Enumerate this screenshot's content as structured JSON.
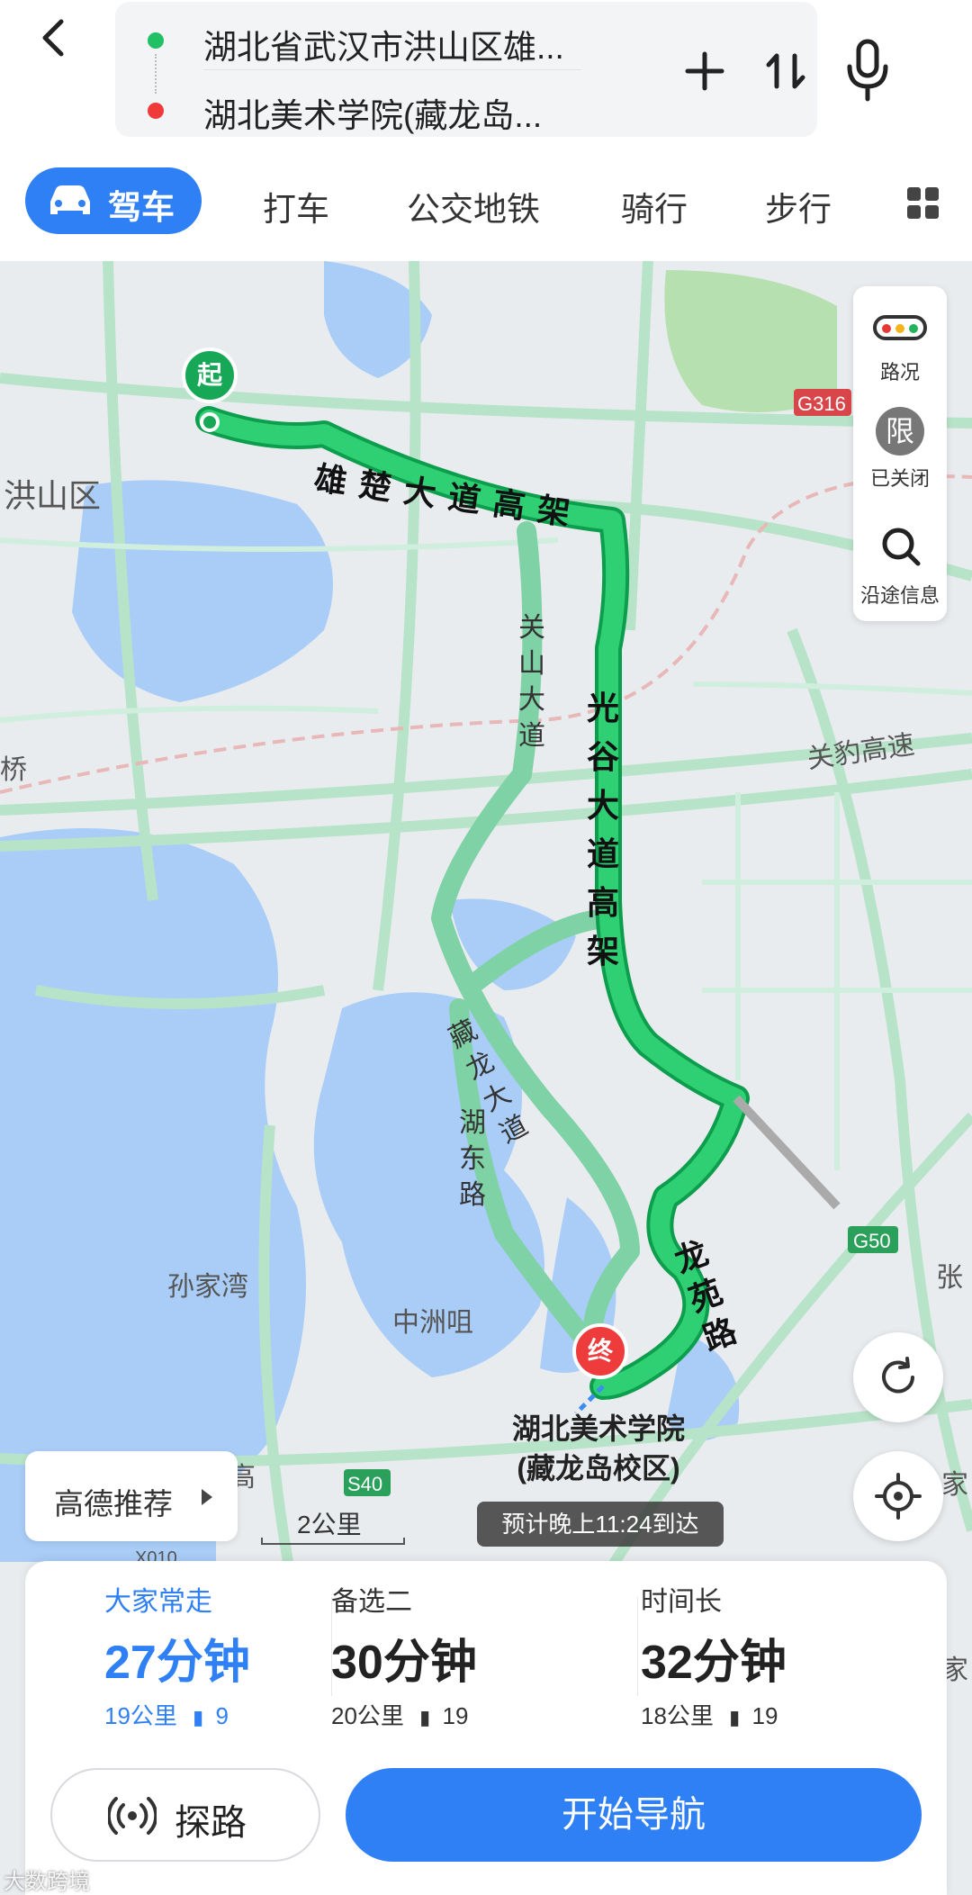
{
  "header": {
    "origin": "湖北省武汉市洪山区雄...",
    "destination": "湖北美术学院(藏龙岛...",
    "icons": [
      "back-arrow-icon",
      "add-icon",
      "swap-icon",
      "microphone-icon"
    ]
  },
  "modes": {
    "drive": "驾车",
    "taxi": "打车",
    "transit": "公交地铁",
    "cycle": "骑行",
    "walk": "步行",
    "more_icon": "grid-icon"
  },
  "tools": {
    "traffic": "路况",
    "restrict_badge": "限",
    "restrict": "已关闭",
    "along": "沿途信息"
  },
  "map": {
    "start_marker": "起",
    "end_marker": "终",
    "destination_label_line1": "湖北美术学院",
    "destination_label_line2": "(藏龙岛校区)",
    "eta": "预计晚上11:24到达",
    "scale": "2公里",
    "recommend": "高德推荐",
    "places": {
      "hongshan": "洪山区",
      "sunjiawan": "孙家湾",
      "zhongzhouju": "中洲咀",
      "guanbao": "关豹高速",
      "g316": "G316",
      "g50": "G50",
      "s40": "S40",
      "qiao": "桥",
      "zhang": "张",
      "jia": "家",
      "jia2": "家",
      "gao": "高",
      "x010": "X010"
    },
    "roads": {
      "xiongchu": "雄楚大道高架",
      "guanggu": "光谷大道高架",
      "guanshan": "关山大道",
      "canglong": "藏龙大道",
      "hudong": "湖东路",
      "longyuan": "龙苑路"
    }
  },
  "routes": [
    {
      "tag": "大家常走",
      "time": "27分钟",
      "distance": "19公里",
      "lights": "9"
    },
    {
      "tag": "备选二",
      "time": "30分钟",
      "distance": "20公里",
      "lights": "19"
    },
    {
      "tag": "时间长",
      "time": "32分钟",
      "distance": "18公里",
      "lights": "19"
    }
  ],
  "actions": {
    "explore": "探路",
    "navigate": "开始导航"
  },
  "watermark": "大数跨境",
  "colors": {
    "accent": "#2f7ff5",
    "route": "#1ec26a",
    "alt_route": "#7fd1a6",
    "water": "#a9cdf7"
  }
}
